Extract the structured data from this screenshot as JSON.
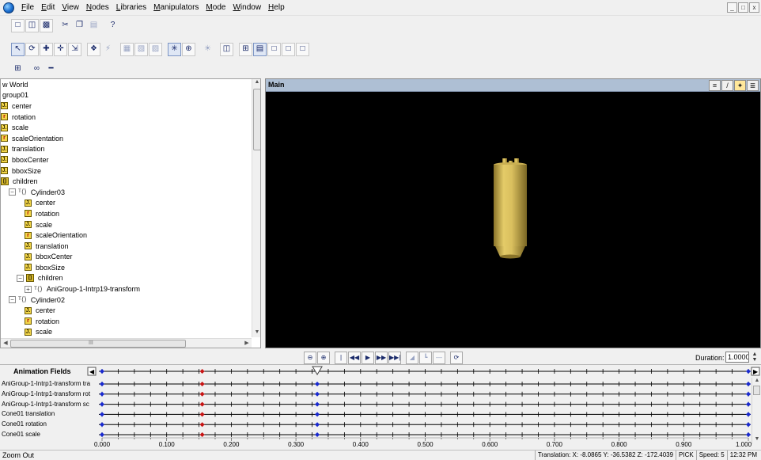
{
  "menubar": {
    "items": [
      {
        "underline": "F",
        "rest": "ile"
      },
      {
        "underline": "E",
        "rest": "dit"
      },
      {
        "underline": "V",
        "rest": "iew"
      },
      {
        "underline": "N",
        "rest": "odes"
      },
      {
        "underline": "L",
        "rest": "ibraries"
      },
      {
        "underline": "M",
        "rest": "anipulators"
      },
      {
        "underline": "M",
        "rest": "ode"
      },
      {
        "underline": "W",
        "rest": "indow"
      },
      {
        "underline": "H",
        "rest": "elp"
      }
    ],
    "window_controls": [
      "_",
      "□",
      "x"
    ]
  },
  "tree": {
    "rows": [
      {
        "indent": 0,
        "kind": "text",
        "label": "w World"
      },
      {
        "indent": 0,
        "kind": "text",
        "label": "group01"
      },
      {
        "indent": 0,
        "kind": "field",
        "glyph": "J.",
        "label": "center"
      },
      {
        "indent": 0,
        "kind": "field-red",
        "glyph": "r",
        "label": "rotation"
      },
      {
        "indent": 0,
        "kind": "field",
        "glyph": "J.",
        "label": "scale"
      },
      {
        "indent": 0,
        "kind": "field-red",
        "glyph": "r",
        "label": "scaleOrientation"
      },
      {
        "indent": 0,
        "kind": "field",
        "glyph": "J.",
        "label": "translation"
      },
      {
        "indent": 0,
        "kind": "field",
        "glyph": "J.",
        "label": "bboxCenter"
      },
      {
        "indent": 0,
        "kind": "field",
        "glyph": "J.",
        "label": "bboxSize"
      },
      {
        "indent": 0,
        "kind": "children",
        "label": "children"
      },
      {
        "indent": 1,
        "kind": "node",
        "expander": "−",
        "label": "Cylinder03"
      },
      {
        "indent": 3,
        "kind": "field",
        "glyph": "J.",
        "label": "center"
      },
      {
        "indent": 3,
        "kind": "field-red",
        "glyph": "r",
        "label": "rotation"
      },
      {
        "indent": 3,
        "kind": "field",
        "glyph": "J.",
        "label": "scale"
      },
      {
        "indent": 3,
        "kind": "field-red",
        "glyph": "r",
        "label": "scaleOrientation"
      },
      {
        "indent": 3,
        "kind": "field",
        "glyph": "J.",
        "label": "translation"
      },
      {
        "indent": 3,
        "kind": "field",
        "glyph": "J.",
        "label": "bboxCenter"
      },
      {
        "indent": 3,
        "kind": "field",
        "glyph": "J.",
        "label": "bboxSize"
      },
      {
        "indent": 2,
        "kind": "children",
        "expander": "−",
        "label": "children"
      },
      {
        "indent": 3,
        "kind": "node",
        "expander": "+",
        "label": "AniGroup-1-Intrp19-transform"
      },
      {
        "indent": 1,
        "kind": "node",
        "expander": "−",
        "label": "Cylinder02"
      },
      {
        "indent": 3,
        "kind": "field",
        "glyph": "J.",
        "label": "center"
      },
      {
        "indent": 3,
        "kind": "field-red",
        "glyph": "r",
        "label": "rotation"
      },
      {
        "indent": 3,
        "kind": "field",
        "glyph": "J.",
        "label": "scale"
      }
    ],
    "hscroll_mark": "III"
  },
  "viewport": {
    "title": "Main",
    "tools": [
      "≡",
      "/",
      "✦",
      "≣"
    ]
  },
  "playback": {
    "buttons": [
      "⊖",
      "⊕",
      "|◀◀",
      "◀◀",
      "▶",
      "▶▶",
      "▶▶|",
      "◢",
      "┗",
      "—",
      "⟳"
    ],
    "duration_label": "Duration:",
    "duration_value": "1.0000"
  },
  "animation": {
    "header": "Animation Fields",
    "tracks": [
      "AniGroup-1-Intrp1-transform tra",
      "AniGroup-1-Intrp1-transform rot",
      "AniGroup-1-Intrp1-transform sc",
      "Cone01 translation",
      "Cone01 rotation",
      "Cone01 scale"
    ],
    "time_ticks": [
      "0.000",
      "0.100",
      "0.200",
      "0.300",
      "0.400",
      "0.500",
      "0.600",
      "0.700",
      "0.800",
      "0.900",
      "1.000"
    ],
    "current_time": 0.333,
    "keyframes": [
      0.0,
      0.155,
      0.333,
      1.0
    ],
    "selected_keyframe": 0.155,
    "colors": {
      "keyframe": "#1a2ad0",
      "selected_keyframe": "#c81414",
      "track_line": "#000000"
    }
  },
  "statusbar": {
    "message": "Zoom Out",
    "translation": "Translation: X: -8.0865  Y: -36.5382  Z: -172.4039",
    "mode": "PICK",
    "speed": "Speed: 5",
    "clock": "12:32 PM"
  },
  "scene": {
    "background": "#000000",
    "object_color": "#d9bf5e"
  }
}
